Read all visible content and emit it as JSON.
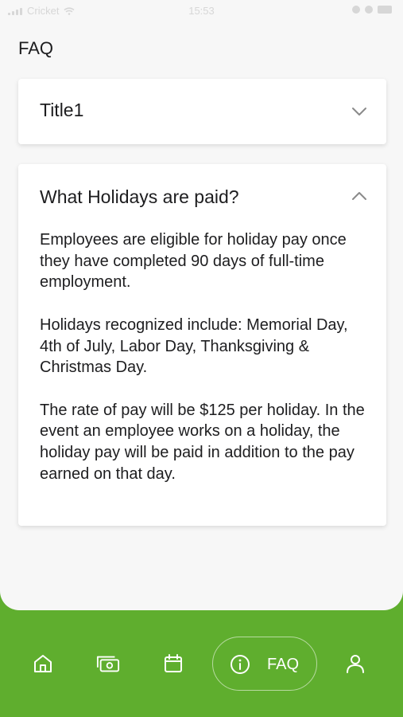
{
  "status_bar": {
    "carrier": "Cricket",
    "time": "15:53"
  },
  "page": {
    "title": "FAQ"
  },
  "faq": {
    "items": [
      {
        "title": "Title1",
        "expanded": false,
        "icon": "chevron-down-icon"
      },
      {
        "title": "What Holidays are paid?",
        "expanded": true,
        "icon": "chevron-up-icon",
        "paragraphs": [
          "Employees are eligible for holiday pay once they have completed 90 days of full-time employment.",
          "Holidays recognized include: Memorial Day, 4th of July, Labor Day, Thanksgiving & Christmas Day.",
          "The rate of pay will be $125 per holiday. In the event an employee works on a holiday, the holiday pay will be paid in addition to the pay earned on that day."
        ]
      }
    ]
  },
  "bottom_nav": {
    "items": [
      {
        "icon": "home-icon"
      },
      {
        "icon": "money-icon"
      },
      {
        "icon": "calendar-icon"
      },
      {
        "icon": "info-icon",
        "label": "FAQ",
        "active": true
      },
      {
        "icon": "user-icon"
      }
    ]
  },
  "colors": {
    "accent": "#5fae2e",
    "background": "#f7f7f7",
    "card": "#ffffff",
    "text": "#1d1d1f"
  }
}
